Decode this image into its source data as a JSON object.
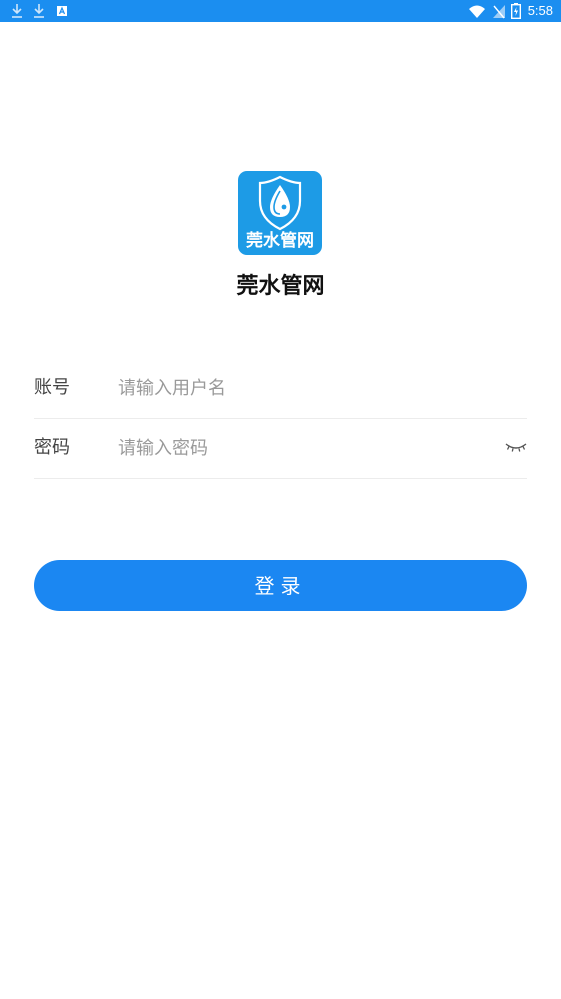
{
  "status_bar": {
    "time": "5:58",
    "left_icons": [
      "download-icon",
      "download-icon",
      "app-notification-icon"
    ],
    "right_icons": [
      "wifi-icon",
      "no-signal-icon",
      "battery-icon"
    ],
    "color": "#1b8ef0"
  },
  "app": {
    "logo_text": "莞水管网",
    "title": "莞水管网",
    "logo_color": "#1d9be6"
  },
  "form": {
    "account_label": "账号",
    "account_placeholder": "请输入用户名",
    "account_value": "",
    "password_label": "密码",
    "password_placeholder": "请输入密码",
    "password_value": "",
    "password_visibility_icon": "eye-closed-icon"
  },
  "login_button": {
    "label": "登录",
    "color": "#1b87f2"
  }
}
